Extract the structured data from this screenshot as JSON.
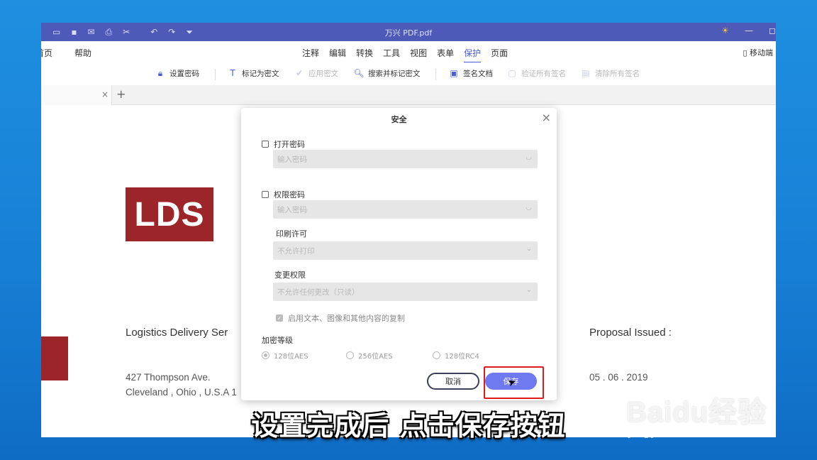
{
  "titlebar": {
    "title": "万兴 PDF.pdf",
    "quick_icons": [
      "folder-icon",
      "save-icon",
      "mail-icon",
      "print-icon",
      "cut-icon",
      "undo-icon",
      "redo-icon",
      "dropdown-icon"
    ],
    "quick_glyphs": [
      "▭",
      "▪",
      "✉",
      "⎙",
      "✂",
      "↶",
      "↷",
      "⏷"
    ],
    "sun_glyph": "☀",
    "minimize_glyph": "—",
    "maximize_glyph": "◻"
  },
  "menubar": {
    "home_label": "首页",
    "help_label": "帮助",
    "tabs": [
      "注释",
      "编辑",
      "转换",
      "工具",
      "视图",
      "表单",
      "保护",
      "页面"
    ],
    "active_tab": "保护",
    "mobile_label": "移动端"
  },
  "toolbar": {
    "set_password": "设置密码",
    "mark_redact": "标记为密文",
    "apply_redact": "应用密文",
    "search_redact": "搜索并标记密文",
    "sign_doc": "签名文档",
    "verify_sigs": "验证所有签名",
    "clear_sigs": "清除所有签名"
  },
  "tabstrip": {
    "close_glyph": "×",
    "new_glyph": "+"
  },
  "document": {
    "logo_text": "LDS",
    "line1": "Logistics Delivery Ser",
    "address1": "427 Thompson Ave.",
    "address2": "Cleveland , Ohio , U.S.A 1",
    "proposal_label": "Proposal Issued :",
    "proposal_date": "05 . 06 . 2019"
  },
  "dialog": {
    "title": "安全",
    "close_glyph": "×",
    "open_password_label": "打开密码",
    "open_password_placeholder": "输入密码",
    "permission_password_label": "权限密码",
    "permission_password_placeholder": "输入密码",
    "eye_glyph": "◡",
    "print_permission_label": "印刷许可",
    "print_permission_value": "不允许打印",
    "change_permission_label": "变更权限",
    "change_permission_value": "不允许任何更改（只读）",
    "chevron_glyph": "⌄",
    "copy_label": "启用文本、图像和其他内容的复制",
    "encryption_label": "加密等级",
    "encryption_options": [
      "128位AES",
      "256位AES",
      "128位RC4"
    ],
    "encryption_selected": "128位AES",
    "cancel_label": "取消",
    "save_label": "保存"
  },
  "subtitle": "设置完成后 点击保存按钮",
  "watermark": {
    "brand": "Baidu经验",
    "url": "jingyan.baidu.com"
  }
}
